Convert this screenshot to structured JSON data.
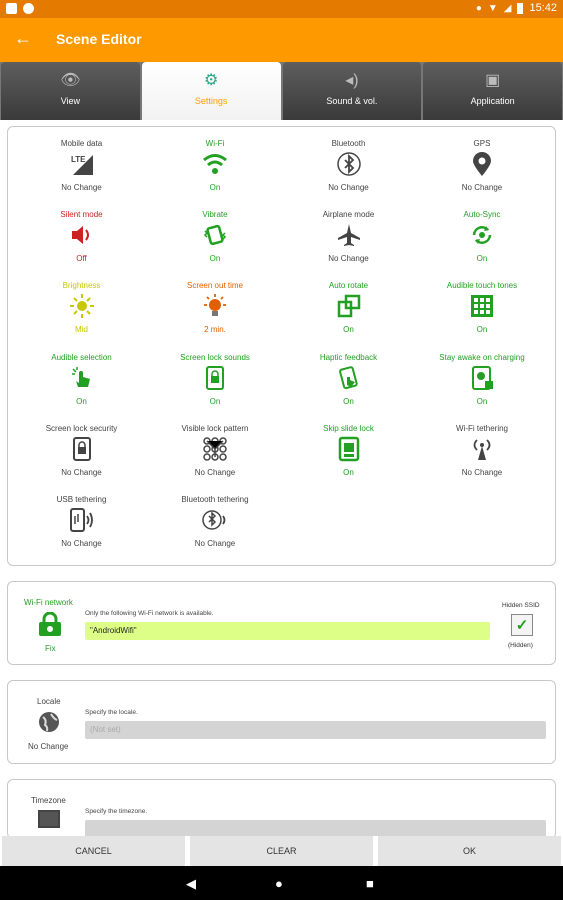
{
  "status": {
    "time": "15:42"
  },
  "appbar": {
    "title": "Scene Editor"
  },
  "tabs": [
    {
      "label": "View",
      "icon": "eye-icon"
    },
    {
      "label": "Settings",
      "icon": "gear-icon"
    },
    {
      "label": "Sound & vol.",
      "icon": "speaker-icon"
    },
    {
      "label": "Application",
      "icon": "gamepad-icon"
    }
  ],
  "settings": [
    {
      "label": "Mobile data",
      "value": "No Change",
      "icon": "lte-signal-icon",
      "color": "#444444"
    },
    {
      "label": "Wi-Fi",
      "value": "On",
      "icon": "wifi-icon",
      "color": "#22a022"
    },
    {
      "label": "Bluetooth",
      "value": "No Change",
      "icon": "bluetooth-icon",
      "color": "#444444"
    },
    {
      "label": "GPS",
      "value": "No Change",
      "icon": "location-pin-icon",
      "color": "#444444"
    },
    {
      "label": "Silent mode",
      "value": "Off",
      "icon": "speaker-icon",
      "color": "#cc2222"
    },
    {
      "label": "Vibrate",
      "value": "On",
      "icon": "vibrate-icon",
      "color": "#22a022"
    },
    {
      "label": "Airplane mode",
      "value": "No Change",
      "icon": "airplane-icon",
      "color": "#444444"
    },
    {
      "label": "Auto-Sync",
      "value": "On",
      "icon": "sync-icon",
      "color": "#22a022"
    },
    {
      "label": "Brightness",
      "value": "Mid",
      "icon": "brightness-icon",
      "color": "#c8c800"
    },
    {
      "label": "Screen out time",
      "value": "2 min.",
      "icon": "bulb-icon",
      "color": "#e06000"
    },
    {
      "label": "Auto rotate",
      "value": "On",
      "icon": "rotate-icon",
      "color": "#22a022"
    },
    {
      "label": "Audible touch tones",
      "value": "On",
      "icon": "keypad-icon",
      "color": "#22a022"
    },
    {
      "label": "Audible selection",
      "value": "On",
      "icon": "touch-sound-icon",
      "color": "#22a022"
    },
    {
      "label": "Screen lock sounds",
      "value": "On",
      "icon": "lock-sound-icon",
      "color": "#22a022"
    },
    {
      "label": "Haptic feedback",
      "value": "On",
      "icon": "haptic-icon",
      "color": "#22a022"
    },
    {
      "label": "Stay awake on charging",
      "value": "On",
      "icon": "stay-awake-icon",
      "color": "#22a022"
    },
    {
      "label": "Screen lock security",
      "value": "No Change",
      "icon": "lock-phone-icon",
      "color": "#444444"
    },
    {
      "label": "Visible lock pattern",
      "value": "No Change",
      "icon": "pattern-icon",
      "color": "#444444"
    },
    {
      "label": "Skip slide lock",
      "value": "On",
      "icon": "slide-lock-icon",
      "color": "#22a022"
    },
    {
      "label": "Wi-Fi tethering",
      "value": "No Change",
      "icon": "hotspot-icon",
      "color": "#444444"
    },
    {
      "label": "USB tethering",
      "value": "No Change",
      "icon": "usb-tether-icon",
      "color": "#444444"
    },
    {
      "label": "Bluetooth tethering",
      "value": "No Change",
      "icon": "bt-tether-icon",
      "color": "#444444"
    }
  ],
  "wifi_network": {
    "title": "Wi-Fi network",
    "status": "Fix",
    "description": "Only the following Wi-Fi network is available.",
    "value": "\"AndroidWifi\"",
    "hidden_ssid_label": "Hidden SSID",
    "hidden_caption": "(Hidden)",
    "hidden_checked": true
  },
  "locale": {
    "title": "Locale",
    "status": "No Change",
    "description": "Specify the locale.",
    "placeholder": "(Not set)"
  },
  "timezone": {
    "title": "Timezone",
    "description": "Specify the timezone."
  },
  "buttons": {
    "cancel": "CANCEL",
    "clear": "CLEAR",
    "ok": "OK"
  },
  "colors": {
    "accent": "#ff9900",
    "statusbar": "#e57a00",
    "on": "#22a022",
    "field_green": "#ddff88"
  }
}
